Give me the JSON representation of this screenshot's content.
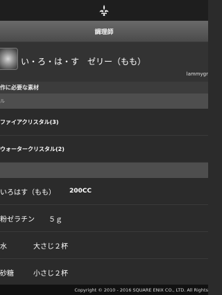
{
  "header": {
    "logo_icon": "fleur-de-lis-icon",
    "title": "調理師"
  },
  "item": {
    "icon": "jelly-item-icon",
    "name": "い・ろ・は・す　ゼリー（もも）",
    "author": "lammygr"
  },
  "materials_label": "作に必要な素材",
  "crystal_section_label": "ル",
  "crystals": [
    {
      "label": "ファイアクリスタル(3)"
    },
    {
      "label": "ウォータークリスタル(2)"
    }
  ],
  "ingredients": [
    {
      "name": "いろはす（もも）",
      "amount": "200CC"
    },
    {
      "name": "粉ゼラチン",
      "amount": "５ｇ"
    },
    {
      "name": "水",
      "amount": "大さじ２杯"
    },
    {
      "name": "砂糖",
      "amount": "小さじ２杯"
    }
  ],
  "footer": {
    "copyright": "Copyright © 2010 - 2016 SQUARE ENIX CO., LTD. All Rights"
  }
}
